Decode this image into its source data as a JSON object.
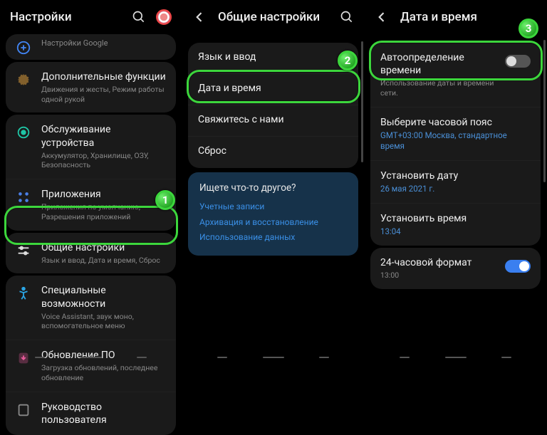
{
  "p1": {
    "header": "Настройки",
    "items": [
      {
        "icon": "google",
        "title": "Настройки Google",
        "sub": ""
      },
      {
        "icon": "gear",
        "title": "Дополнительные функции",
        "sub": "Движения и жесты, Режим работы одной рукой"
      },
      {
        "icon": "target",
        "title": "Обслуживание устройства",
        "sub": "Аккумулятор, Хранилище, ОЗУ, Безопасность"
      },
      {
        "icon": "apps",
        "title": "Приложения",
        "sub": "Приложения по умолчанию, Разрешения приложений"
      },
      {
        "icon": "sliders",
        "title": "Общие настройки",
        "sub": "Язык и ввод, Дата и время, Сброс"
      },
      {
        "icon": "access",
        "title": "Специальные возможности",
        "sub": "Voice Assistant, звук моно, вспомогательное меню"
      },
      {
        "icon": "update",
        "title": "Обновление ПО",
        "sub": "Загрузка обновлений, последнее обновление"
      },
      {
        "icon": "book",
        "title": "Руководство пользователя",
        "sub": ""
      }
    ],
    "badge": "1"
  },
  "p2": {
    "header": "Общие настройки",
    "items": [
      {
        "title": "Язык и ввод"
      },
      {
        "title": "Дата и время"
      },
      {
        "title": "Свяжитесь с нами"
      },
      {
        "title": "Сброс"
      }
    ],
    "suggest": {
      "q": "Ищете что-то другое?",
      "links": [
        "Учетные записи",
        "Архивация и восстановление",
        "Использование данных"
      ]
    },
    "badge": "2"
  },
  "p3": {
    "header": "Дата и время",
    "auto": {
      "title": "Автоопределение времени",
      "sub": "Использование даты и времени сети."
    },
    "tz": {
      "title": "Выберите часовой пояс",
      "sub": "GMT+03:00 Москва, стандартное время"
    },
    "date": {
      "title": "Установить дату",
      "sub": "26 мая 2021 г."
    },
    "time": {
      "title": "Установить время",
      "sub": "13:04"
    },
    "fmt": {
      "title": "24-часовой формат",
      "sub": "13:00"
    },
    "badge": "3"
  }
}
